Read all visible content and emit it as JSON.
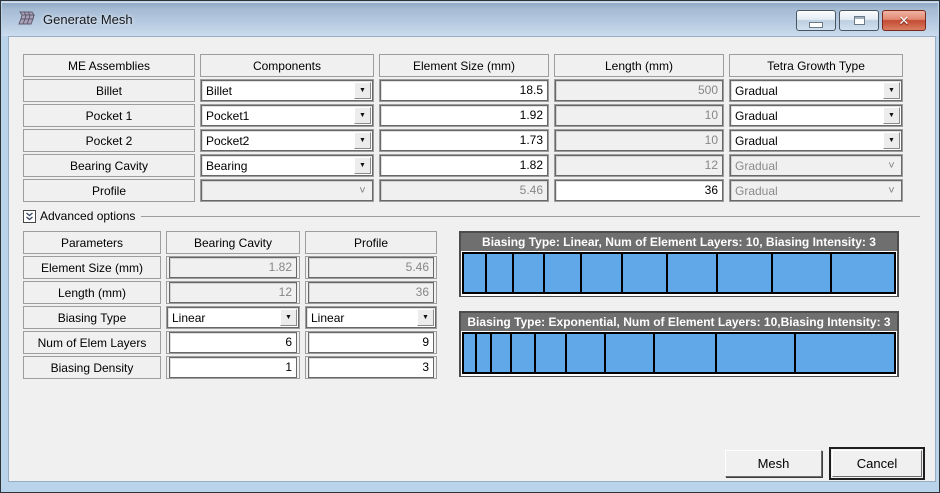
{
  "window": {
    "title": "Generate Mesh",
    "controls": {
      "minimize": "Minimize",
      "maximize": "Maximize",
      "close": "Close"
    }
  },
  "icons": {
    "dropdown": "▼",
    "dropdown_disabled": "˅",
    "close": "✕"
  },
  "colors": {
    "segment_blue": "#61a8e8",
    "panel_header_gray": "#6f6f6f",
    "close_red": "#c44a33",
    "titlebar_blue": "#b5c9df"
  },
  "mesh_table": {
    "headers": [
      "ME Assemblies",
      "Components",
      "Element Size (mm)",
      "Length (mm)",
      "Tetra Growth Type"
    ],
    "rows": [
      {
        "assembly": "Billet",
        "component": "Billet",
        "element_size": "18.5",
        "length": "500",
        "growth": "Gradual"
      },
      {
        "assembly": "Pocket 1",
        "component": "Pocket1",
        "element_size": "1.92",
        "length": "10",
        "growth": "Gradual"
      },
      {
        "assembly": "Pocket 2",
        "component": "Pocket2",
        "element_size": "1.73",
        "length": "10",
        "growth": "Gradual"
      },
      {
        "assembly": "Bearing Cavity",
        "component": "Bearing",
        "element_size": "1.82",
        "length": "12",
        "growth": "Gradual"
      },
      {
        "assembly": "Profile",
        "component": "",
        "element_size": "5.46",
        "length": "36",
        "growth": "Gradual"
      }
    ]
  },
  "advanced": {
    "label": "Advanced options",
    "params_table": {
      "headers": [
        "Parameters",
        "Bearing Cavity",
        "Profile"
      ],
      "rows": [
        {
          "label": "Element Size (mm)",
          "bearing": "1.82",
          "profile": "5.46"
        },
        {
          "label": "Length (mm)",
          "bearing": "12",
          "profile": "36"
        },
        {
          "label": "Biasing Type",
          "bearing": "Linear",
          "profile": "Linear"
        },
        {
          "label": "Num of Elem Layers",
          "bearing": "6",
          "profile": "9"
        },
        {
          "label": "Biasing Density",
          "bearing": "1",
          "profile": "3"
        }
      ]
    },
    "biasing_panels": [
      {
        "title": "Biasing Type: Linear, Num of Element Layers: 10, Biasing Intensity: 3",
        "type": "Linear",
        "num_layers": 10,
        "intensity": 3,
        "segments": [
          1.0,
          1.22,
          1.44,
          1.67,
          1.89,
          2.11,
          2.33,
          2.56,
          2.78,
          3.0
        ]
      },
      {
        "title": "Biasing Type: Exponential, Num of Element Layers: 10,Biasing Intensity: 3",
        "type": "Exponential",
        "num_layers": 10,
        "intensity": 3,
        "segments": [
          1.0,
          1.28,
          1.64,
          2.1,
          2.68,
          3.44,
          4.4,
          5.63,
          7.21,
          9.22
        ]
      }
    ]
  },
  "buttons": {
    "mesh": "Mesh",
    "cancel": "Cancel"
  }
}
